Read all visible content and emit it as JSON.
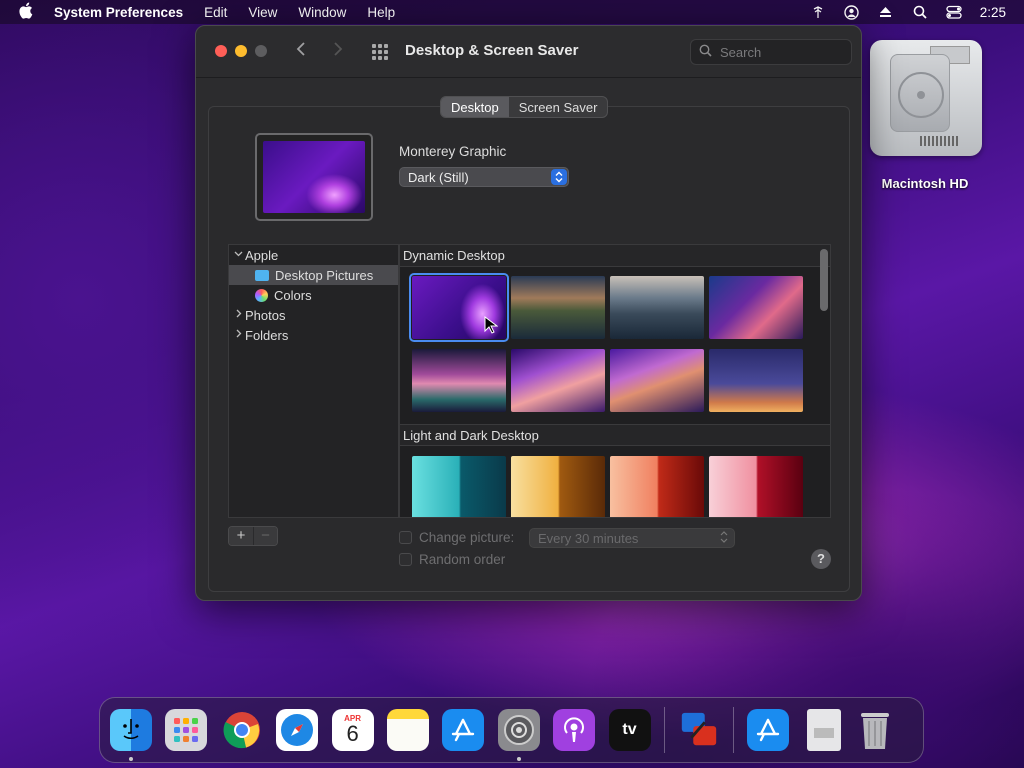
{
  "menubar": {
    "app_name": "System Preferences",
    "menus": [
      "Edit",
      "View",
      "Window",
      "Help"
    ],
    "clock": "2:25"
  },
  "desktop": {
    "disk_label": "Macintosh HD"
  },
  "window": {
    "title": "Desktop & Screen Saver",
    "search_placeholder": "Search",
    "tabs": [
      {
        "label": "Desktop",
        "selected": true
      },
      {
        "label": "Screen Saver",
        "selected": false
      }
    ],
    "wallpaper_name": "Monterey Graphic",
    "appearance_value": "Dark (Still)",
    "sidebar": {
      "items": [
        {
          "label": "Apple",
          "expanded": true
        },
        {
          "label": "Desktop Pictures",
          "selected": true
        },
        {
          "label": "Colors"
        },
        {
          "label": "Photos",
          "expanded": false
        },
        {
          "label": "Folders",
          "expanded": false
        }
      ]
    },
    "gallery": {
      "sections": [
        {
          "title": "Dynamic Desktop"
        },
        {
          "title": "Light and Dark Desktop"
        }
      ]
    },
    "change_picture_label": "Change picture:",
    "change_interval": "Every 30 minutes",
    "random_order_label": "Random order",
    "help_label": "?",
    "add_label": "+",
    "remove_label": "−"
  },
  "dock": {
    "calendar_month": "APR",
    "calendar_day": "6",
    "tv_label": "tv"
  },
  "colors": {
    "accent": "#2a6fe0",
    "close": "#ff5f57",
    "minimize": "#febc2e"
  }
}
